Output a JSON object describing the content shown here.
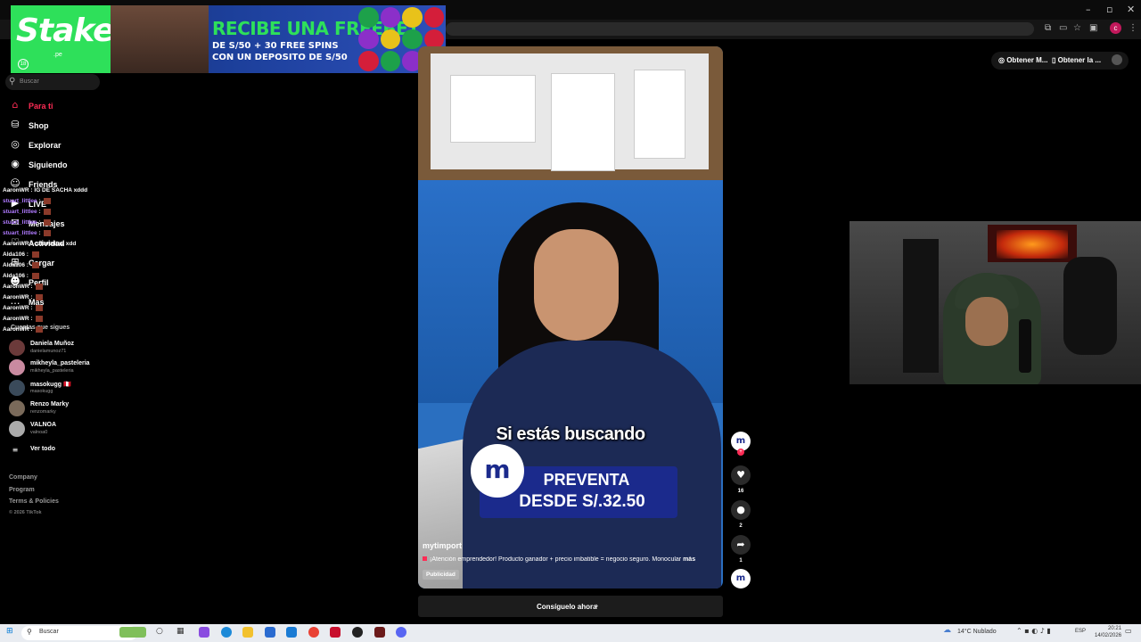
{
  "browser": {
    "minimize_glyph": "–",
    "maximize_glyph": "▫",
    "close_glyph": "✕",
    "profile_initial": "c"
  },
  "ad_banner": {
    "brand": "Stake",
    "brand_suffix": ".pe",
    "age_badge": "18",
    "headline": "RECIBE UNA FREEBET",
    "line2": "DE S/50 + 30 FREE SPINS",
    "line3": "CON UN DEPOSITO DE S/50",
    "colors": {
      "brand_green": "#2ee05a",
      "bg_blue": "#1c3f9a"
    }
  },
  "top_right": {
    "button1": "Obtener M...",
    "button2": "Obtener la ..."
  },
  "sidebar": {
    "search_placeholder": "Buscar",
    "nav": [
      {
        "label": "Para ti",
        "icon": "home-icon",
        "active": true
      },
      {
        "label": "Shop",
        "icon": "shop-icon"
      },
      {
        "label": "Explorar",
        "icon": "compass-icon"
      },
      {
        "label": "Siguiendo",
        "icon": "following-icon"
      },
      {
        "label": "Friends",
        "icon": "friends-icon"
      },
      {
        "label": "LIVE",
        "icon": "live-icon"
      },
      {
        "label": "Mensajes",
        "icon": "messages-icon"
      },
      {
        "label": "Actividad",
        "icon": "activity-icon"
      },
      {
        "label": "Cargar",
        "icon": "upload-icon"
      },
      {
        "label": "Perfil",
        "icon": "profile-icon"
      },
      {
        "label": "Más",
        "icon": "more-icon"
      }
    ],
    "following_header": "Cuentas que sigues",
    "following": [
      {
        "name": "Daniela Muñoz",
        "handle": "danielamunoz71"
      },
      {
        "name": "mikheyla_pasteleria",
        "handle": "mikheyla_pasteleria"
      },
      {
        "name": "masokugg 🇵🇪",
        "handle": "masokugg"
      },
      {
        "name": "Renzo Marky",
        "handle": "renzomarky"
      },
      {
        "name": "VALNOA",
        "handle": "valnoa0"
      }
    ],
    "see_all": "Ver todo",
    "footer": [
      "Company",
      "Program",
      "Terms & Policies"
    ],
    "copyright": "© 2026 TikTok"
  },
  "chat": [
    {
      "user": "AaronWR",
      "text": "IG DE SACHA xddd",
      "purple": false
    },
    {
      "user": "stuart_littlee",
      "text": "",
      "purple": true
    },
    {
      "user": "stuart_littlee",
      "text": "",
      "purple": true
    },
    {
      "user": "stuart_littlee",
      "text": "",
      "purple": true
    },
    {
      "user": "stuart_littlee",
      "text": "",
      "purple": true
    },
    {
      "user": "AaronWR",
      "text": "calaveritaa xdd",
      "purple": false
    },
    {
      "user": "Alda106",
      "text": "",
      "purple": false
    },
    {
      "user": "Alda106",
      "text": "",
      "purple": false
    },
    {
      "user": "Alda106",
      "text": "",
      "purple": false
    },
    {
      "user": "AaronWR",
      "text": "",
      "purple": false
    },
    {
      "user": "AaronWR",
      "text": "",
      "purple": false
    },
    {
      "user": "AaronWR",
      "text": "",
      "purple": false
    },
    {
      "user": "AaronWR",
      "text": "",
      "purple": false
    },
    {
      "user": "AaronWR",
      "text": "",
      "purple": false
    }
  ],
  "video": {
    "caption": "Si estás buscando",
    "promo_line1": "PREVENTA",
    "promo_line2": "DESDE S/.32.50",
    "logo_letter": "m",
    "author": "mytimport",
    "description": "¡Atención emprendedor! Producto ganador + precio imbatible = negocio seguro. Monocular",
    "more": "más",
    "ad_label": "Publicidad",
    "likes": "16",
    "comments": "2",
    "shares": "1"
  },
  "cta": {
    "label": "Consíguelo ahora",
    "chevron": "›"
  },
  "taskbar": {
    "search": "Buscar",
    "weather": "14°C  Nublado",
    "lang": "ESP",
    "time": "20:21",
    "date": "14/02/2026"
  }
}
